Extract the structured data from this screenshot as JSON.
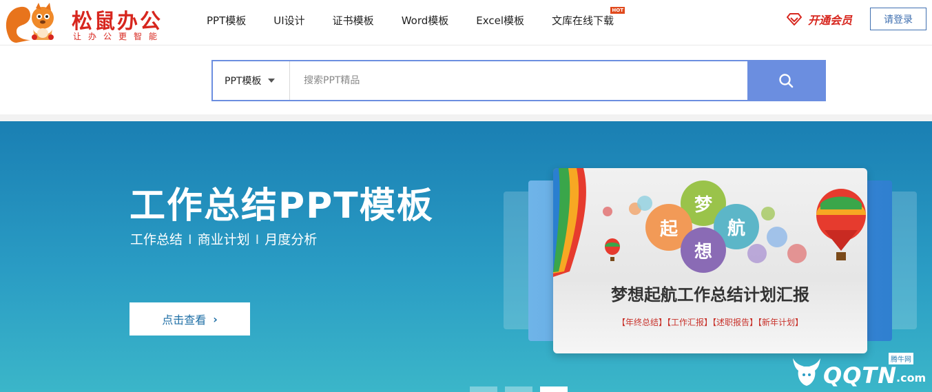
{
  "brand": {
    "name": "松鼠办公",
    "slogan": "让办公更智能"
  },
  "nav": {
    "items": [
      {
        "label": "PPT模板"
      },
      {
        "label": "UI设计"
      },
      {
        "label": "证书模板"
      },
      {
        "label": "Word模板"
      },
      {
        "label": "Excel模板"
      },
      {
        "label": "文库在线下载",
        "badge": "HOT"
      }
    ]
  },
  "header": {
    "vip_label": "开通会员",
    "login_label": "请登录"
  },
  "search": {
    "category": "PPT模板",
    "placeholder": "搜索PPT精品"
  },
  "banner": {
    "title": "工作总结PPT模板",
    "tags": [
      "工作总结",
      "商业计划",
      "月度分析"
    ],
    "separator": "I",
    "button_label": "点击查看",
    "card": {
      "bubbles": [
        "梦",
        "起",
        "航",
        "想"
      ],
      "title": "梦想起航工作总结计划汇报",
      "tags": "【年终总结】【工作汇报】【述职报告】【新年计划】"
    },
    "slides": 3,
    "active_slide": 3
  },
  "watermark": {
    "text": "QQTN",
    "badge": "腾牛网",
    "suffix": ".com"
  },
  "colors": {
    "brand_red": "#d7261e",
    "accent_blue": "#6b8ee0",
    "login_blue": "#3f6fb0"
  }
}
